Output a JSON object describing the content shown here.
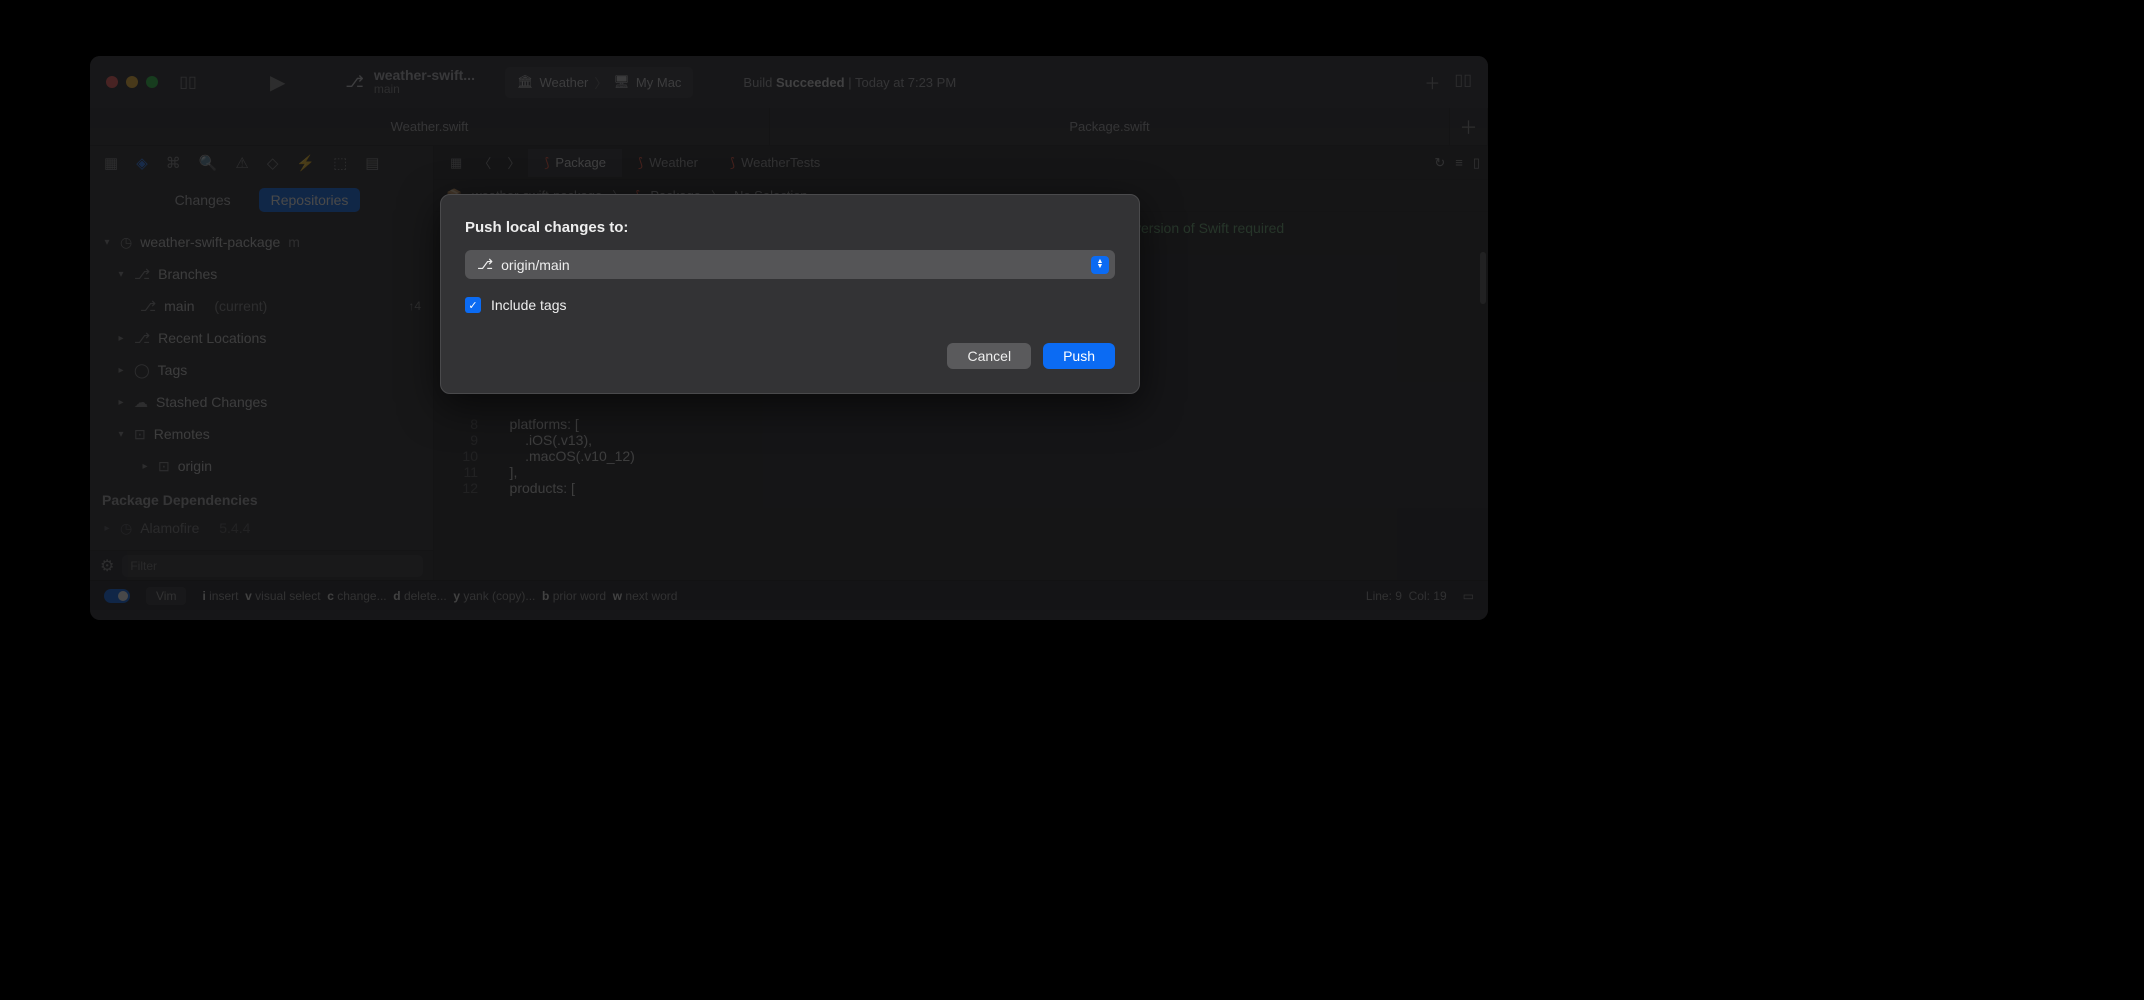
{
  "titlebar": {
    "project": "weather-swift...",
    "branch": "main",
    "scheme_target": "Weather",
    "scheme_dest": "My Mac",
    "build_prefix": "Build ",
    "build_status": "Succeeded",
    "build_sep": " | ",
    "build_time": "Today at 7:23 PM"
  },
  "tabs": {
    "t1": "Weather.swift",
    "t2": "Package.swift"
  },
  "sidebar": {
    "seg_changes": "Changes",
    "seg_repos": "Repositories",
    "root": "weather-swift-package",
    "root_suffix": "m",
    "branches": "Branches",
    "main": "main",
    "main_tag": "(current)",
    "main_badge": "↑4",
    "recent": "Recent Locations",
    "tags": "Tags",
    "stashed": "Stashed Changes",
    "remotes": "Remotes",
    "origin": "origin",
    "dep_title": "Package Dependencies",
    "dep1": "Alamofire",
    "dep1_ver": "5.4.4",
    "filter_ph": "Filter"
  },
  "editor": {
    "etabs": {
      "package": "Package",
      "weather": "Weather",
      "tests": "WeatherTests"
    },
    "bread": {
      "a": "weather-swift-package",
      "b": "Package",
      "c": "No Selection"
    },
    "partial_line": "version of Swift required",
    "lines": [
      {
        "n": "8",
        "t": "    platforms: ["
      },
      {
        "n": "9",
        "t": "        .iOS(.v13),"
      },
      {
        "n": "10",
        "t": "        .macOS(.v10_12)"
      },
      {
        "n": "11",
        "t": "    ],"
      },
      {
        "n": "12",
        "t": "    products: ["
      }
    ]
  },
  "status": {
    "vim": "Vim",
    "hints": [
      {
        "k": "i",
        "t": "insert"
      },
      {
        "k": "v",
        "t": "visual select"
      },
      {
        "k": "c",
        "t": "change..."
      },
      {
        "k": "d",
        "t": "delete..."
      },
      {
        "k": "y",
        "t": "yank (copy)..."
      },
      {
        "k": "b",
        "t": "prior word"
      },
      {
        "k": "w",
        "t": "next word"
      }
    ],
    "line": "Line: 9",
    "col": "Col: 19"
  },
  "dialog": {
    "title": "Push local changes to:",
    "dropdown": "origin/main",
    "checkbox": "Include tags",
    "cancel": "Cancel",
    "push": "Push"
  }
}
